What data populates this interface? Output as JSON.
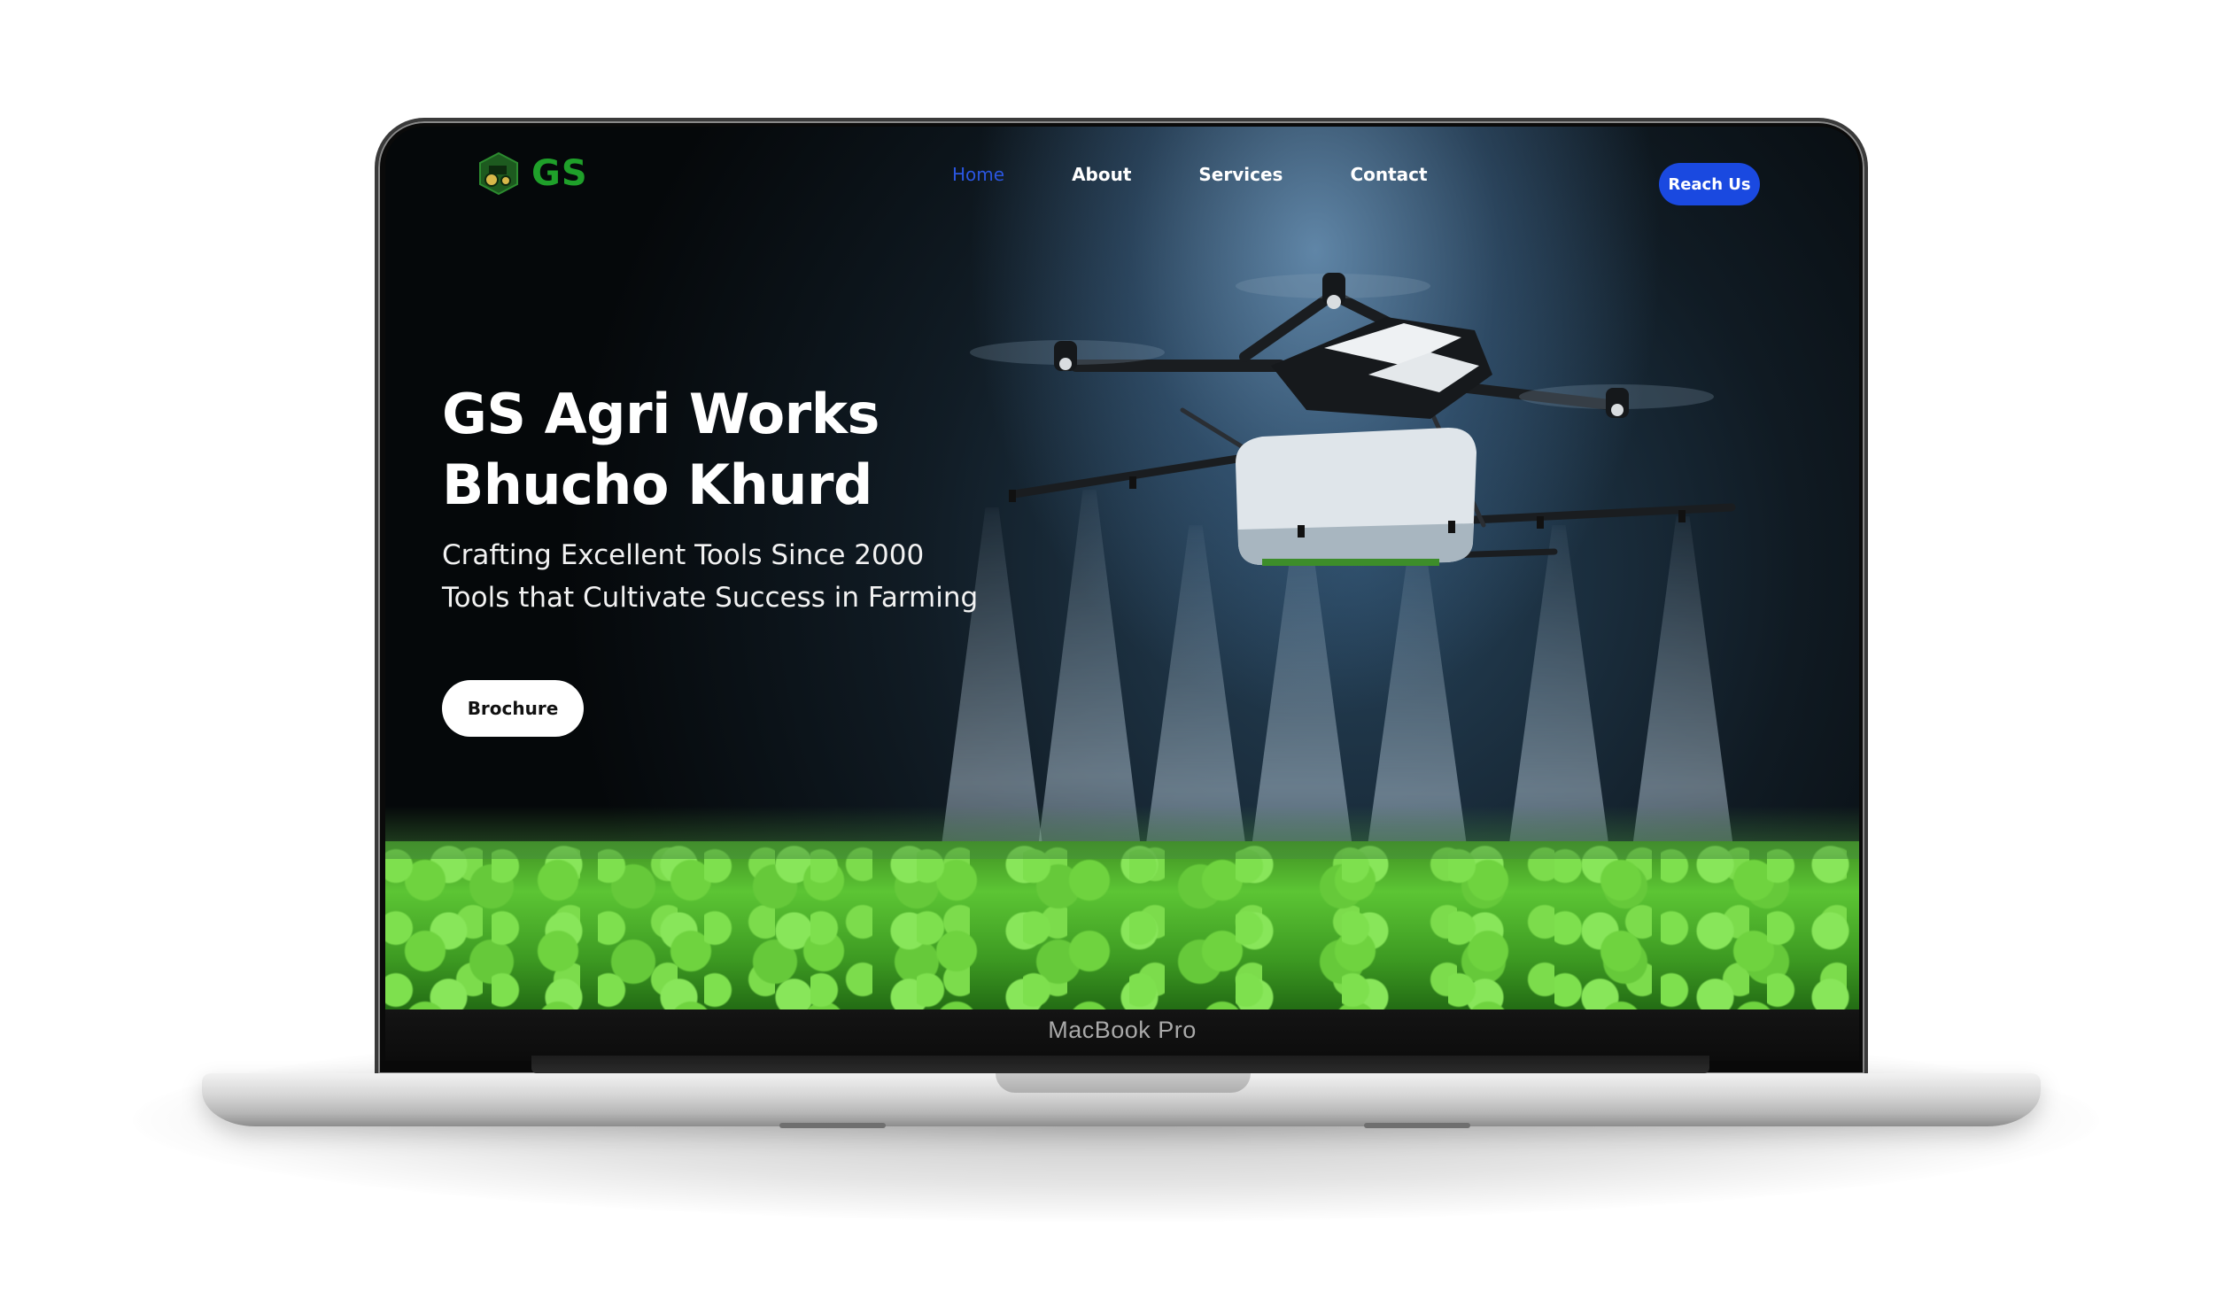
{
  "device": {
    "model_label": "MacBook Pro"
  },
  "site": {
    "brand": {
      "name": "GS"
    },
    "nav": {
      "items": [
        {
          "label": "Home",
          "active": true
        },
        {
          "label": "About",
          "active": false
        },
        {
          "label": "Services",
          "active": false
        },
        {
          "label": "Contact",
          "active": false
        }
      ],
      "cta_label": "Reach Us"
    },
    "hero": {
      "title_line1": "GS Agri Works",
      "title_line2": "Bhucho Khurd",
      "subtitle_line1": "Crafting Excellent Tools Since 2000",
      "subtitle_line2": "Tools that Cultivate Success in Farming",
      "button_label": "Brochure"
    }
  },
  "colors": {
    "accent_blue": "#1a49e0",
    "active_link": "#2a56e0",
    "brand_green": "#1fa02a"
  },
  "icons": {
    "logo": "tractor-badge-icon"
  }
}
